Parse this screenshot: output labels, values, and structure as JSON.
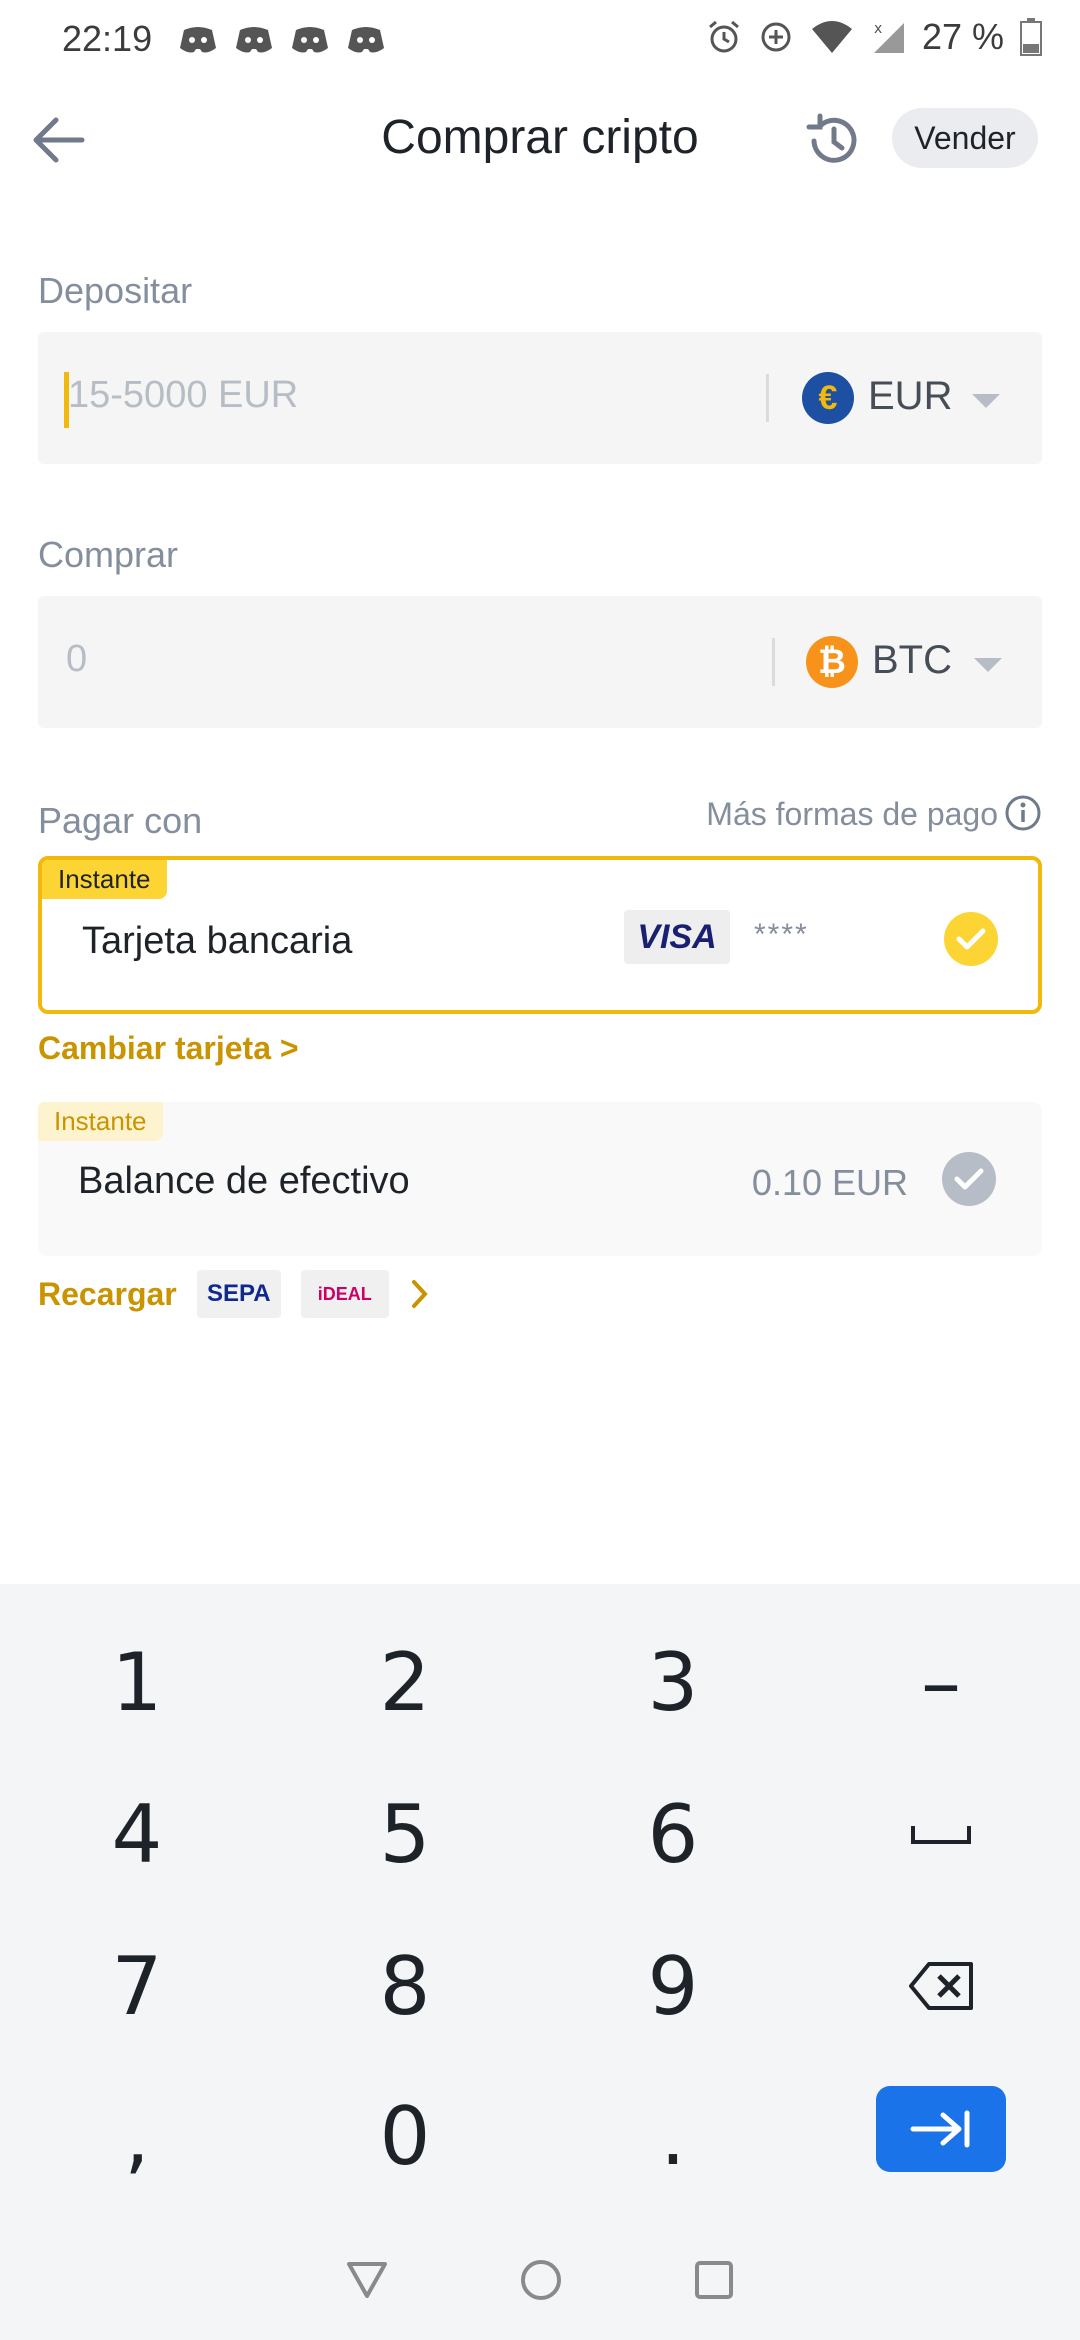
{
  "status_bar": {
    "time": "22:19",
    "battery": "27 %",
    "icons": [
      "discord-icon",
      "discord-icon",
      "discord-icon",
      "discord-icon",
      "alarm-icon",
      "data-saver-icon",
      "wifi-icon",
      "signal-icon",
      "battery-icon"
    ]
  },
  "header": {
    "title": "Comprar cripto",
    "sell_label": "Vender"
  },
  "deposit": {
    "label": "Depositar",
    "placeholder": "15-5000 EUR",
    "currency": "EUR",
    "currency_symbol": "€"
  },
  "buy": {
    "label": "Comprar",
    "value": "0",
    "currency": "BTC",
    "currency_symbol": "₿"
  },
  "payment": {
    "label": "Pagar con",
    "more_methods": "Más formas de pago",
    "options": [
      {
        "badge": "Instante",
        "title": "Tarjeta bancaria",
        "brand": "VISA",
        "masked": "****",
        "selected": true
      },
      {
        "badge": "Instante",
        "title": "Balance de efectivo",
        "balance": "0.10 EUR",
        "selected": false
      }
    ],
    "change_card": "Cambiar tarjeta >",
    "recharge": "Recargar",
    "recharge_methods": [
      "SEPA",
      "iDEAL"
    ]
  },
  "keypad": {
    "keys": [
      "1",
      "2",
      "3",
      "–",
      "4",
      "5",
      "6",
      "␣",
      "7",
      "8",
      "9",
      "⌫",
      ",",
      "0",
      ".",
      "⇥"
    ]
  },
  "colors": {
    "accent": "#f0b90b",
    "link": "#c99400",
    "eur_coin": "#1d4fa3",
    "btc_coin": "#f7931a",
    "go_key": "#1a73e8"
  }
}
